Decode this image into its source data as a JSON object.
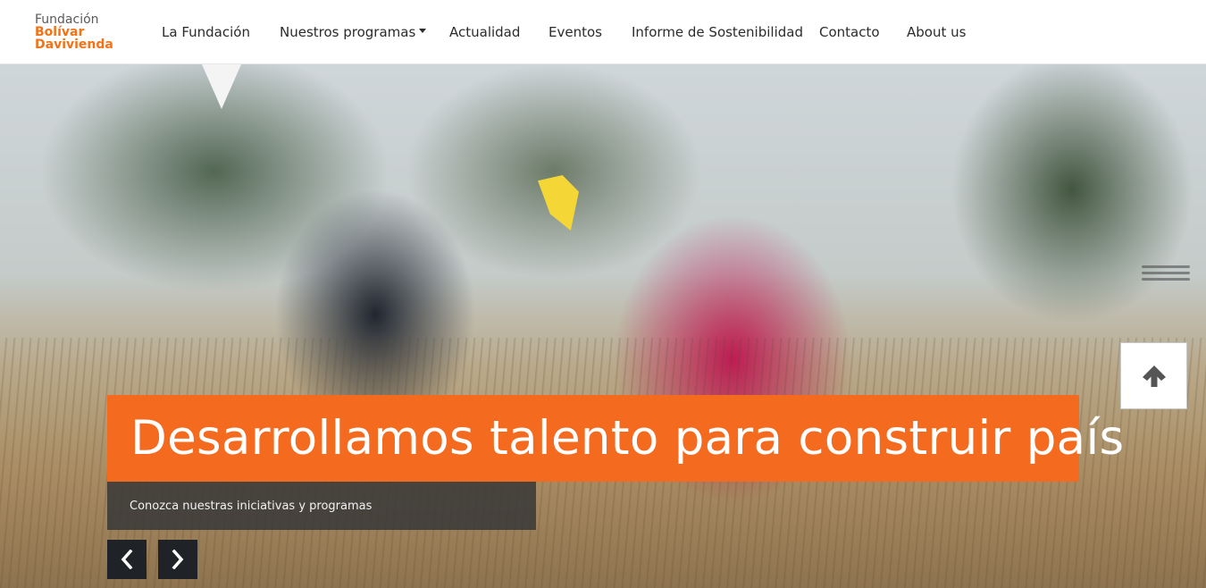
{
  "logo": {
    "line1": "Fundación",
    "line2": "Bolívar",
    "line3": "Davivienda"
  },
  "nav": {
    "items": [
      {
        "label": "La Fundación"
      },
      {
        "label": "Nuestros programas"
      },
      {
        "label": "Actualidad"
      },
      {
        "label": "Eventos"
      },
      {
        "label": "Informe de Sostenibilidad"
      },
      {
        "label": "Contacto"
      },
      {
        "label": "About us"
      }
    ]
  },
  "hero": {
    "headline": "Desarrollamos talento para construir país",
    "subtitle": "Conozca nuestras iniciativas y programas"
  },
  "colors": {
    "accent": "#f46a1e",
    "brand_gray": "#5a5a5a",
    "dark_button": "#1f2328"
  },
  "icons": {
    "menu": "hamburger-menu-icon",
    "scroll_top": "arrow-up-icon",
    "prev": "chevron-left-icon",
    "next": "chevron-right-icon"
  }
}
